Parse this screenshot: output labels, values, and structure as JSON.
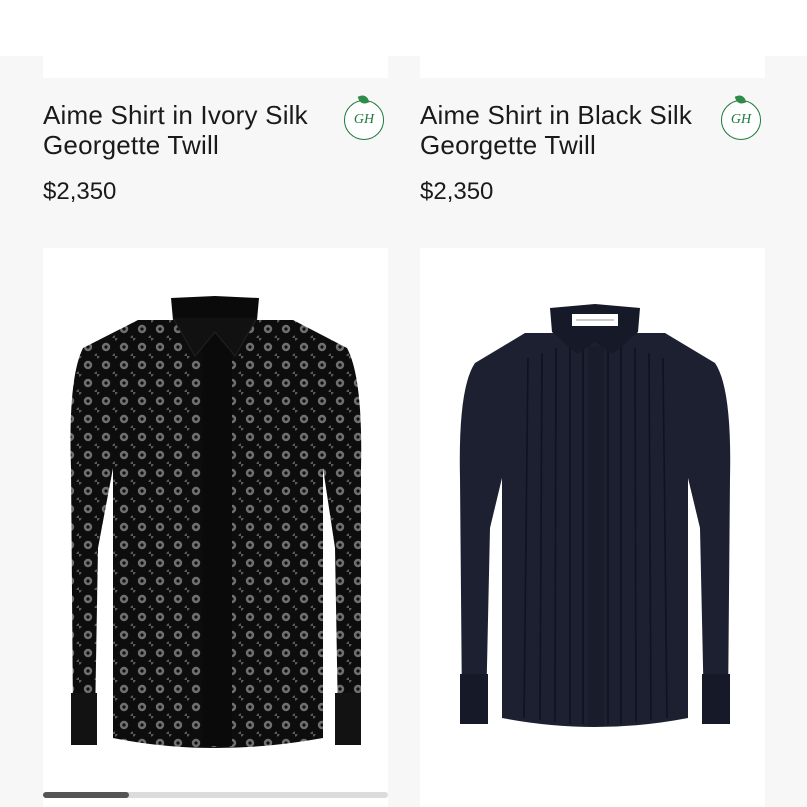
{
  "products": [
    {
      "title": "Aime Shirt in Ivory Silk Georgette Twill",
      "price": "$2,350",
      "badge": "GH",
      "badge_icon": "brand-monogram-icon"
    },
    {
      "title": "Aime Shirt in Black Silk Georgette Twill",
      "price": "$2,350",
      "badge": "GH",
      "badge_icon": "brand-monogram-icon"
    }
  ],
  "gallery": [
    {
      "image": "black-lace-shirt-image"
    },
    {
      "image": "navy-pleated-shirt-image"
    }
  ],
  "scroll": {
    "progress": 0.25
  },
  "colors": {
    "background": "#f7f7f7",
    "card": "#ffffff",
    "text": "#1a1a1a",
    "badge_green": "#1f7a3f"
  }
}
